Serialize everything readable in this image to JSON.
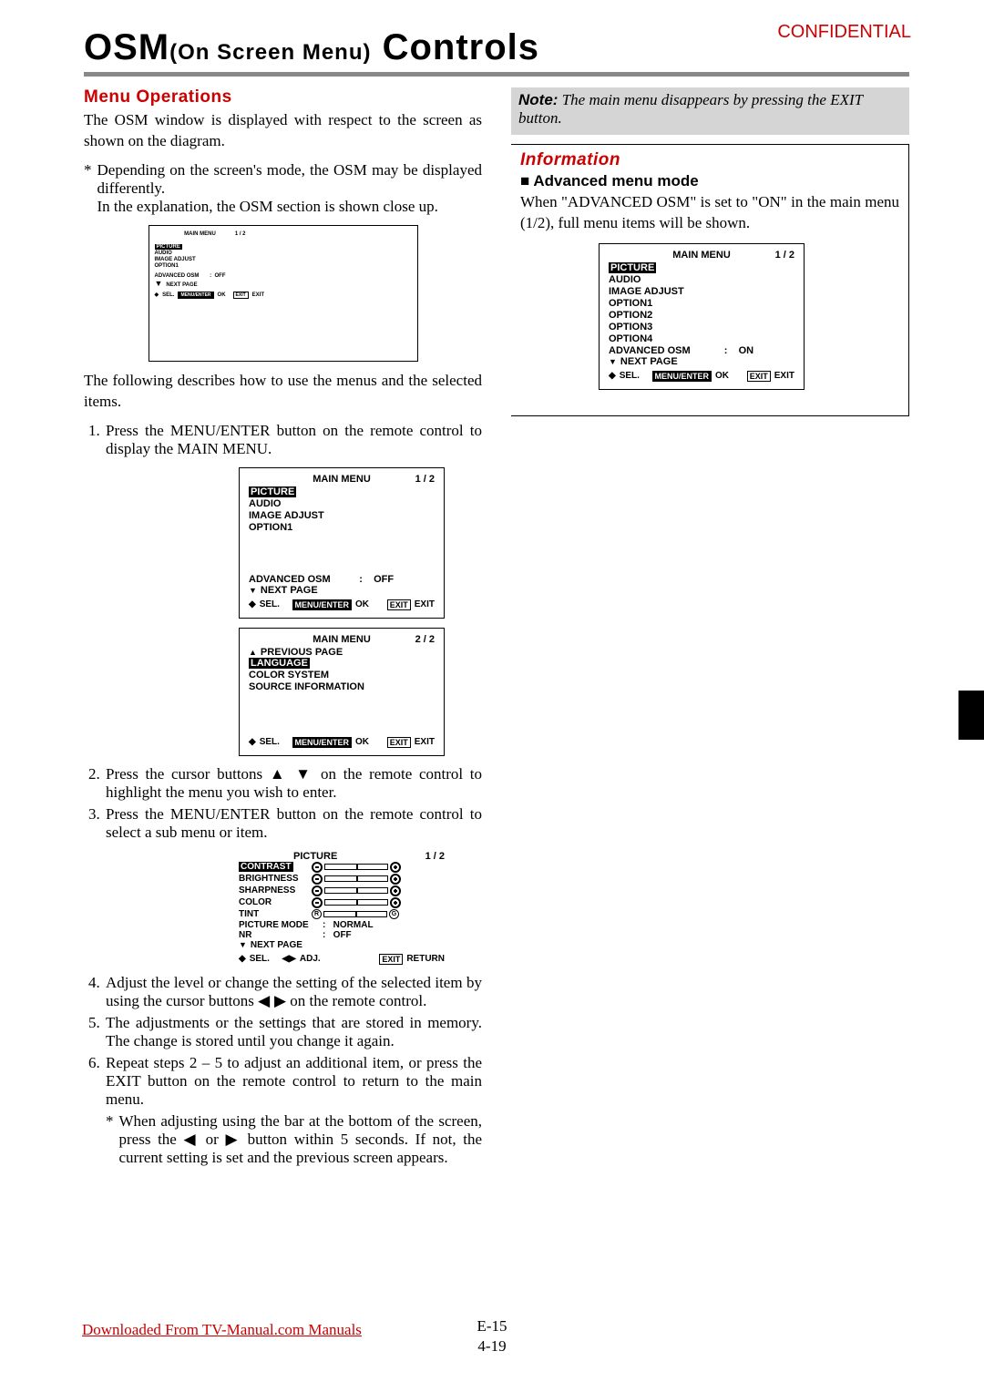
{
  "confidential": "CONFIDENTIAL",
  "title_osm": "OSM",
  "title_paren": "(On Screen Menu)",
  "title_controls": " Controls",
  "left": {
    "heading": "Menu Operations",
    "intro": "The OSM window is displayed with respect to the screen as shown on the diagram.",
    "star_note": "Depending on the screen's mode, the OSM may be displayed differently.",
    "star_note2": "In the explanation, the OSM section is shown close up.",
    "intro2": "The following describes how to use the menus and the selected items.",
    "steps": {
      "s1": "Press the MENU/ENTER button on the remote control to display the MAIN MENU.",
      "s2_a": "Press the cursor buttons ",
      "s2_b": " on the remote control to highlight the menu you wish to enter.",
      "s3": "Press the MENU/ENTER button on the remote control to select a sub menu or item.",
      "s4_a": "Adjust the level or change the setting of the selected item by using the cursor buttons ",
      "s4_b": " on the remote control.",
      "s5": "The adjustments or the settings that are stored in memory. The change is stored until you change it again.",
      "s6": "Repeat steps 2 – 5 to adjust an additional item, or press the EXIT button on the remote control to return to the main menu.",
      "s6_star_a": "When adjusting using the bar at the bottom of the screen, press the ",
      "s6_star_b": " or ",
      "s6_star_c": " button within 5 seconds. If not, the current setting is set and the previous screen appears."
    }
  },
  "menus": {
    "small": {
      "title": "MAIN MENU",
      "page": "1 / 2",
      "items": [
        "PICTURE",
        "AUDIO",
        "IMAGE ADJUST",
        "OPTION1"
      ],
      "adv": "ADVANCED OSM",
      "adv_val": "OFF",
      "next": "NEXT PAGE",
      "sel": "SEL.",
      "ok": "OK",
      "me": "MENU/ENTER",
      "exit": "EXIT",
      "exit2": "EXIT"
    },
    "main1": {
      "title": "MAIN MENU",
      "page": "1 / 2",
      "items": [
        "PICTURE",
        "AUDIO",
        "IMAGE ADJUST",
        "OPTION1"
      ],
      "adv": "ADVANCED OSM",
      "adv_val": "OFF",
      "next": "NEXT PAGE",
      "sel": "SEL.",
      "ok": "OK",
      "me": "MENU/ENTER",
      "exit": "EXIT",
      "exit2": "EXIT"
    },
    "main2": {
      "title": "MAIN MENU",
      "page": "2 / 2",
      "nav": "PREVIOUS PAGE",
      "items": [
        "LANGUAGE",
        "COLOR SYSTEM",
        "SOURCE INFORMATION"
      ],
      "sel": "SEL.",
      "ok": "OK",
      "me": "MENU/ENTER",
      "exit": "EXIT",
      "exit2": "EXIT"
    },
    "picture": {
      "title": "PICTURE",
      "page": "1 / 2",
      "rows": [
        "CONTRAST",
        "BRIGHTNESS",
        "SHARPNESS",
        "COLOR",
        "TINT"
      ],
      "pm": "PICTURE MODE",
      "pm_val": "NORMAL",
      "nr": "NR",
      "nr_val": "OFF",
      "next": "NEXT PAGE",
      "sel": "SEL.",
      "adj": "ADJ.",
      "exit": "EXIT",
      "ret": "RETURN",
      "tintR": "R",
      "tintG": "G"
    },
    "adv": {
      "title": "MAIN MENU",
      "page": "1 / 2",
      "items": [
        "PICTURE",
        "AUDIO",
        "IMAGE ADJUST",
        "OPTION1",
        "OPTION2",
        "OPTION3",
        "OPTION4"
      ],
      "adv": "ADVANCED OSM",
      "adv_val": "ON",
      "next": "NEXT PAGE",
      "sel": "SEL.",
      "ok": "OK",
      "me": "MENU/ENTER",
      "exit": "EXIT",
      "exit2": "EXIT"
    }
  },
  "right": {
    "note_label": "Note:",
    "note_text": " The main menu disappears by pressing the EXIT button.",
    "info_head": "Information",
    "sub_head": " Advanced menu mode",
    "sub_text": "When \"ADVANCED OSM\" is set to \"ON\" in the main menu (1/2), full menu items will be shown."
  },
  "arrows": {
    "up": "▲",
    "down": "▼",
    "left": "◀",
    "right": "▶",
    "updown": "▲ ▼",
    "lr": "◀  ▶"
  },
  "footer": {
    "download": "Downloaded From TV-Manual.com Manuals",
    "page_a": "E-15",
    "page_b": "4-19"
  }
}
